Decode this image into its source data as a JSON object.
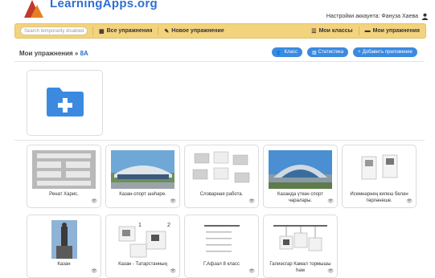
{
  "header": {
    "logo_text": "LearningApps.org",
    "account_label": "Настройки аккаунта: Фануза Хаева"
  },
  "navbar": {
    "search_placeholder": "Search temporarily disabled",
    "items": [
      {
        "label": "Все упражнения",
        "icon": "grid-icon"
      },
      {
        "label": "Новое упражнение",
        "icon": "pencil-icon"
      },
      {
        "label": "Мои классы",
        "icon": "list-icon"
      },
      {
        "label": "Мои упражнения",
        "icon": "folder-icon"
      }
    ]
  },
  "breadcrumb": {
    "title": "Мои упражнения",
    "sep": "»",
    "class_name": "8А"
  },
  "actions": {
    "class_btn": "Класс",
    "stats_btn": "Статистика",
    "add_btn": "Добавить приложение"
  },
  "cards_row1": [
    {
      "title": "Ренат Харис.",
      "thumb": "form-template"
    },
    {
      "title": "Казан-спорт шәһәре.",
      "thumb": "stadium-photo"
    },
    {
      "title": "Словарная работа.",
      "thumb": "grid-template"
    },
    {
      "title": "Казанда үткән спорт чаралары.",
      "thumb": "arena-photo"
    },
    {
      "title": "Исемнәрнең килеш белән төрләнеше.",
      "thumb": "cards-template"
    }
  ],
  "cards_row2": [
    {
      "title": "Казан",
      "thumb": "monument-photo"
    },
    {
      "title": "Казан - Татарстанның",
      "thumb": "numbered-template"
    },
    {
      "title": "Г.Афзал 8 класс",
      "thumb": "lines-template"
    },
    {
      "title": "Галиәсгар Камал тормышы һәм",
      "thumb": "hanging-template"
    }
  ],
  "colors": {
    "navbar": "#f3d37e",
    "accent": "#3b8ae0",
    "folder": "#3b8ae0"
  }
}
